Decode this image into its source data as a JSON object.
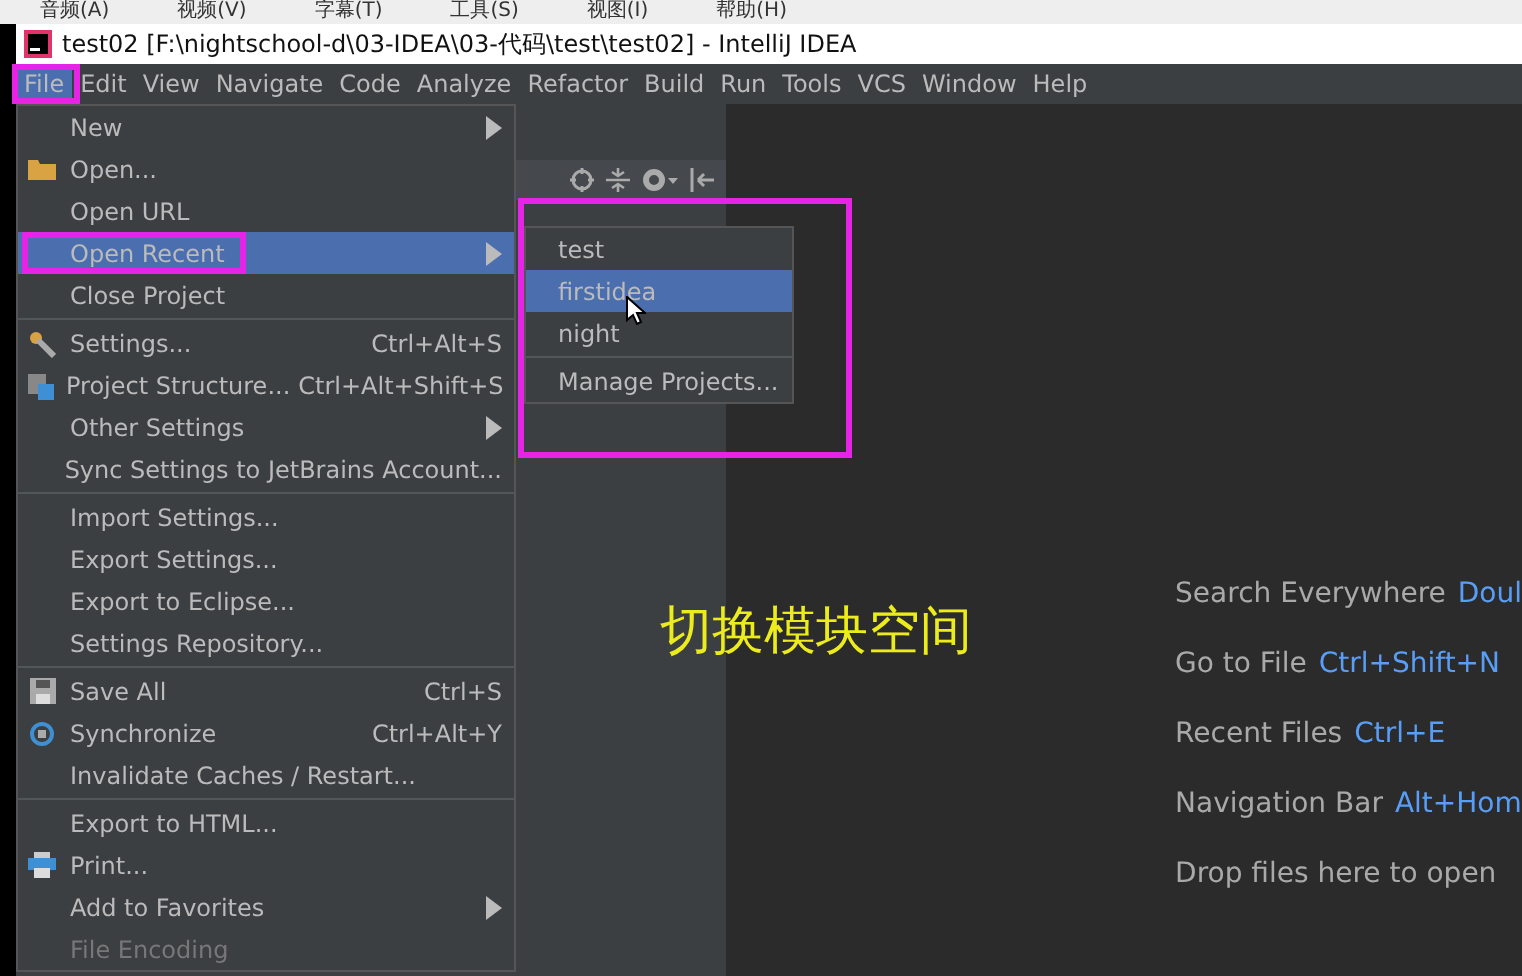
{
  "background_menu": [
    "音频(A)",
    "视频(V)",
    "字幕(T)",
    "工具(S)",
    "视图(I)",
    "帮助(H)"
  ],
  "window": {
    "title": "test02 [F:\\nightschool-d\\03-IDEA\\03-代码\\test\\test02] - IntelliJ IDEA"
  },
  "menu_bar": [
    {
      "label": "File",
      "selected": true
    },
    {
      "label": "Edit",
      "selected": false
    },
    {
      "label": "View",
      "selected": false
    },
    {
      "label": "Navigate",
      "selected": false
    },
    {
      "label": "Code",
      "selected": false
    },
    {
      "label": "Analyze",
      "selected": false
    },
    {
      "label": "Refactor",
      "selected": false
    },
    {
      "label": "Build",
      "selected": false
    },
    {
      "label": "Run",
      "selected": false
    },
    {
      "label": "Tools",
      "selected": false
    },
    {
      "label": "VCS",
      "selected": false
    },
    {
      "label": "Window",
      "selected": false
    },
    {
      "label": "Help",
      "selected": false
    }
  ],
  "file_menu": [
    {
      "kind": "item",
      "label": "New",
      "submenu": true,
      "selected": false,
      "disabled": false
    },
    {
      "kind": "item",
      "label": "Open...",
      "selected": false,
      "disabled": false
    },
    {
      "kind": "item",
      "label": "Open URL",
      "selected": false,
      "disabled": false
    },
    {
      "kind": "item",
      "label": "Open Recent",
      "submenu": true,
      "selected": true,
      "disabled": false
    },
    {
      "kind": "item",
      "label": "Close Project",
      "selected": false,
      "disabled": false
    },
    {
      "kind": "separator"
    },
    {
      "kind": "item",
      "label": "Settings...",
      "shortcut": "Ctrl+Alt+S",
      "selected": false,
      "disabled": false
    },
    {
      "kind": "item",
      "label": "Project Structure...",
      "shortcut": "Ctrl+Alt+Shift+S",
      "selected": false,
      "disabled": false
    },
    {
      "kind": "item",
      "label": "Other Settings",
      "submenu": true,
      "selected": false,
      "disabled": false
    },
    {
      "kind": "item",
      "label": "Sync Settings to JetBrains Account...",
      "selected": false,
      "disabled": false
    },
    {
      "kind": "separator"
    },
    {
      "kind": "item",
      "label": "Import Settings...",
      "selected": false,
      "disabled": false
    },
    {
      "kind": "item",
      "label": "Export Settings...",
      "selected": false,
      "disabled": false
    },
    {
      "kind": "item",
      "label": "Export to Eclipse...",
      "selected": false,
      "disabled": false
    },
    {
      "kind": "item",
      "label": "Settings Repository...",
      "selected": false,
      "disabled": false
    },
    {
      "kind": "separator"
    },
    {
      "kind": "item",
      "label": "Save All",
      "shortcut": "Ctrl+S",
      "selected": false,
      "disabled": false
    },
    {
      "kind": "item",
      "label": "Synchronize",
      "shortcut": "Ctrl+Alt+Y",
      "selected": false,
      "disabled": false
    },
    {
      "kind": "item",
      "label": "Invalidate Caches / Restart...",
      "selected": false,
      "disabled": false
    },
    {
      "kind": "separator"
    },
    {
      "kind": "item",
      "label": "Export to HTML...",
      "selected": false,
      "disabled": false
    },
    {
      "kind": "item",
      "label": "Print...",
      "selected": false,
      "disabled": false
    },
    {
      "kind": "item",
      "label": "Add to Favorites",
      "submenu": true,
      "selected": false,
      "disabled": false
    },
    {
      "kind": "item",
      "label": "File Encoding",
      "selected": false,
      "disabled": true
    }
  ],
  "recent_submenu": [
    {
      "kind": "item",
      "label": "test",
      "selected": false
    },
    {
      "kind": "item",
      "label": "firstidea",
      "selected": true
    },
    {
      "kind": "item",
      "label": "night",
      "selected": false
    },
    {
      "kind": "separator"
    },
    {
      "kind": "item",
      "label": "Manage Projects...",
      "selected": false
    }
  ],
  "annotation": "切换模块空间",
  "editor_hints": [
    {
      "label": "Search Everywhere",
      "shortcut": "Doul"
    },
    {
      "label": "Go to File",
      "shortcut": "Ctrl+Shift+N"
    },
    {
      "label": "Recent Files",
      "shortcut": "Ctrl+E"
    },
    {
      "label": "Navigation Bar",
      "shortcut": "Alt+Hom"
    },
    {
      "label": "Drop files here to open"
    }
  ]
}
